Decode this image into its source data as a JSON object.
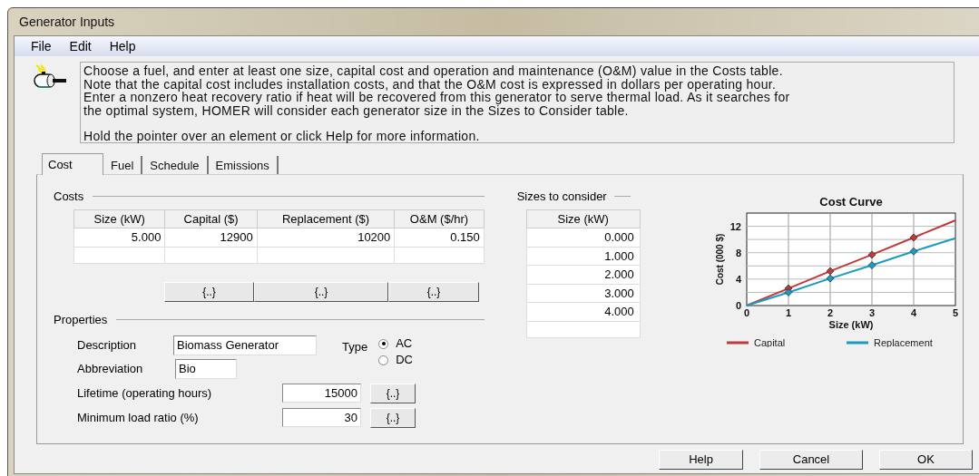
{
  "window": {
    "title": "Generator Inputs"
  },
  "menu": [
    "File",
    "Edit",
    "Help"
  ],
  "info": {
    "lines": [
      "Choose a fuel, and enter at least one size, capital cost and operation and maintenance (O&M) value in the Costs table.",
      "Note that the capital cost includes installation costs, and that the O&M cost is expressed in dollars per operating hour.",
      "Enter a nonzero heat recovery ratio if heat will be recovered from this generator to serve thermal load. As it searches for",
      "the optimal system, HOMER will consider each generator size in the Sizes to Consider table."
    ],
    "hint": "Hold the pointer over an element or click Help for more information."
  },
  "tabs": [
    {
      "label": "Cost",
      "selected": true
    },
    {
      "label": "Fuel",
      "selected": false
    },
    {
      "label": "Schedule",
      "selected": false
    },
    {
      "label": "Emissions",
      "selected": false
    }
  ],
  "costs": {
    "title": "Costs",
    "columns": [
      "Size (kW)",
      "Capital ($)",
      "Replacement ($)",
      "O&M ($/hr)"
    ],
    "rows": [
      [
        "5.000",
        "12900",
        "10200",
        "0.150"
      ]
    ],
    "buttons": [
      "{..}",
      "{..}",
      "{..}"
    ]
  },
  "properties": {
    "title": "Properties",
    "description": {
      "label": "Description",
      "value": "Biomass Generator"
    },
    "abbreviation": {
      "label": "Abbreviation",
      "value": "Bio"
    },
    "type": {
      "label": "Type",
      "options": [
        {
          "label": "AC",
          "selected": true
        },
        {
          "label": "DC",
          "selected": false
        }
      ]
    },
    "fields": [
      {
        "label": "Lifetime (operating hours)",
        "value": "15000",
        "button": "{..}"
      },
      {
        "label": "Minimum load ratio (%)",
        "value": "30",
        "button": "{..}"
      }
    ]
  },
  "sizes": {
    "title": "Sizes to consider",
    "column": "Size (kW)",
    "rows": [
      "0.000",
      "1.000",
      "2.000",
      "3.000",
      "4.000"
    ]
  },
  "chart_data": {
    "type": "line",
    "title": "Cost Curve",
    "xlabel": "Size (kW)",
    "ylabel": "Cost (000 $)",
    "x": [
      0,
      1,
      2,
      3,
      4,
      5
    ],
    "xlim": [
      0,
      5
    ],
    "ylim": [
      0,
      14
    ],
    "xticks": [
      0,
      1,
      2,
      3,
      4,
      5
    ],
    "yticks": [
      0,
      4,
      8,
      12
    ],
    "grid": true,
    "legend": true,
    "series": [
      {
        "name": "Capital",
        "color": "#c0393b",
        "values": [
          0,
          2.6,
          5.2,
          7.7,
          10.3,
          12.9
        ]
      },
      {
        "name": "Replacement",
        "color": "#1a9bc0",
        "values": [
          0,
          2.0,
          4.1,
          6.1,
          8.2,
          10.2
        ]
      }
    ]
  },
  "buttons": [
    "Help",
    "Cancel",
    "OK"
  ]
}
